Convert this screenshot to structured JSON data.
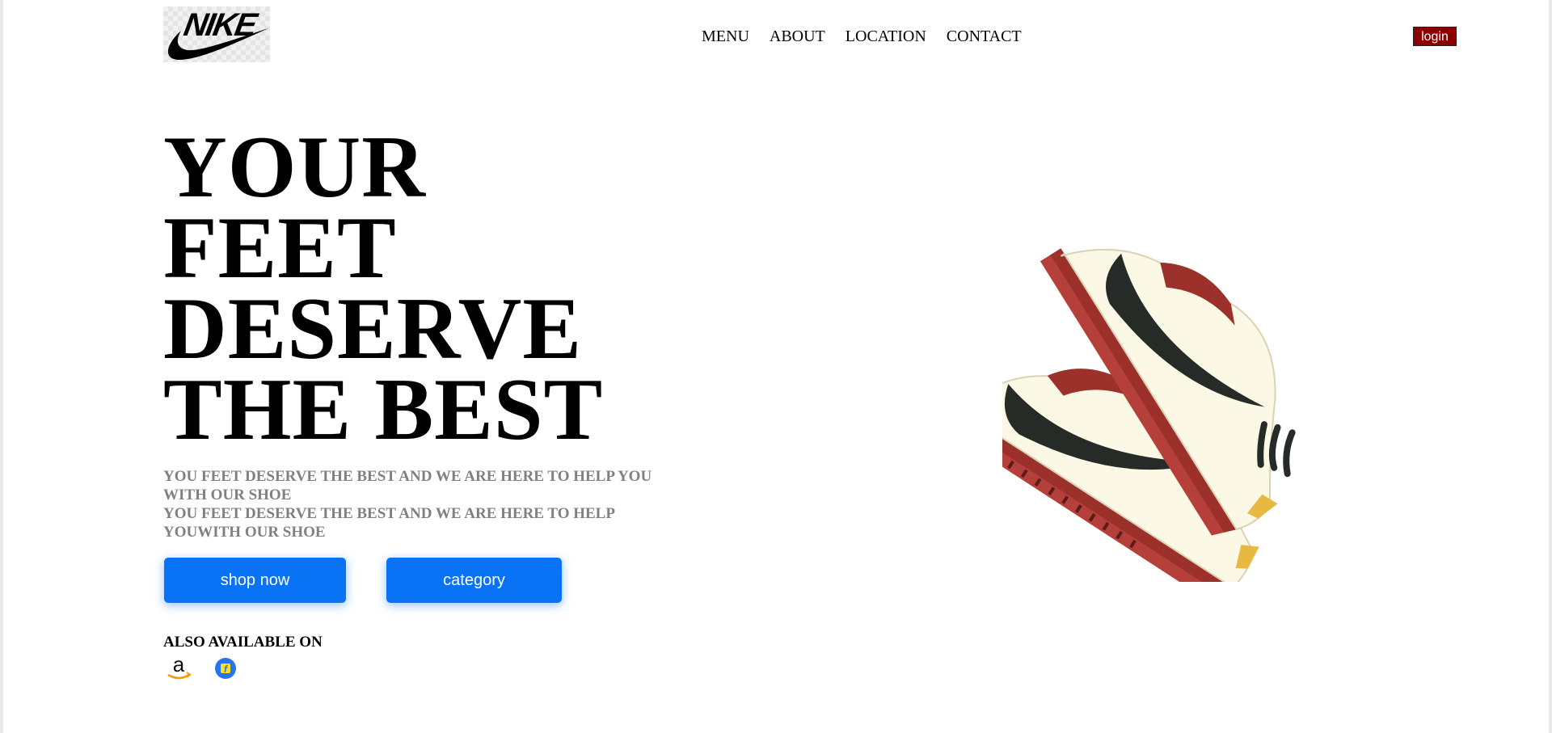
{
  "brand": {
    "logo_text": "NIKE"
  },
  "nav": {
    "items": [
      "MENU",
      "ABOUT",
      "LOCATION",
      "CONTACT"
    ]
  },
  "login_label": "login",
  "hero": {
    "headline": [
      "YOUR",
      "FEET",
      "DESERVE",
      "THE BEST"
    ],
    "subtext": [
      "YOU FEET DESERVE THE BEST AND WE ARE HERE TO HELP YOU WITH OUR SHOE",
      "YOU FEET DESERVE THE BEST AND WE ARE HERE TO HELP YOUWITH OUR SHOE"
    ],
    "buttons": {
      "shop": "shop now",
      "category": "category"
    },
    "also_available": "ALSO AVAILABLE ON"
  },
  "icons": {
    "amazon": "amazon-icon",
    "flipkart": "flipkart-icon",
    "shoe_image": "sneakers-image"
  },
  "colors": {
    "login_bg": "#8b0000",
    "button_bg": "#0a73f5",
    "subtext": "#808080",
    "shoe_sole": "#b5403a",
    "shoe_body": "#fbf8e6",
    "swoosh": "#262b28"
  }
}
